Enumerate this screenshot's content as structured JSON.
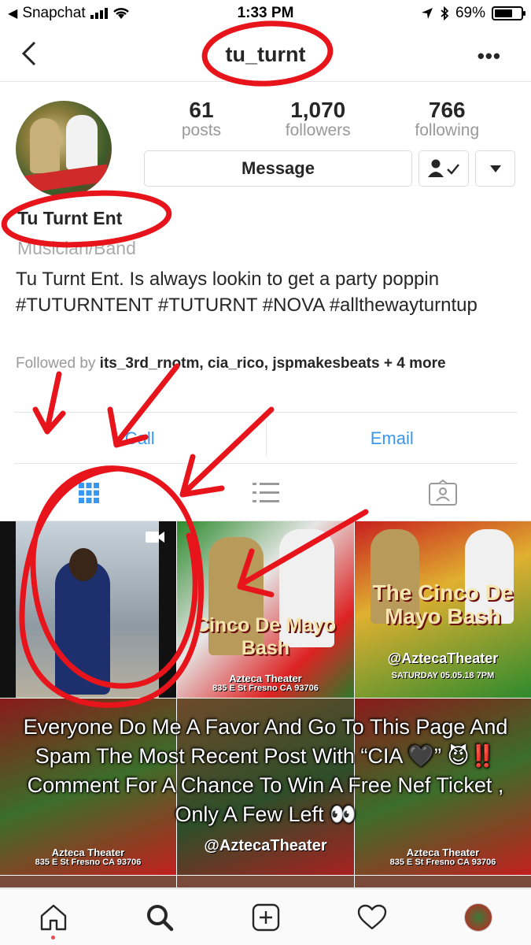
{
  "status_bar": {
    "carrier": "Snapchat",
    "time": "1:33 PM",
    "battery": "69%",
    "battery_level": 0.69
  },
  "nav": {
    "title": "tu_turnt"
  },
  "profile": {
    "stats": [
      {
        "value": "61",
        "label": "posts"
      },
      {
        "value": "1,070",
        "label": "followers"
      },
      {
        "value": "766",
        "label": "following"
      }
    ],
    "message_label": "Message",
    "name": "Tu Turnt Ent",
    "category": "Musician/Band",
    "bio": "Tu Turnt Ent. Is always lookin to get a party poppin #TUTURNTENT #TUTURNT #NOVA #allthewayturntup",
    "followed_prefix": "Followed by",
    "followed_names": "its_3rd_rnotm, cia_rico, jspmakesbeats",
    "followed_suffix": "+ 4 more"
  },
  "contact": {
    "left_label": "Call",
    "right_label": "Email"
  },
  "grid_posts": {
    "post2_title": "Cinco De Mayo Bash",
    "post2_venue": "Azteca Theater",
    "post2_address": "835 E St Fresno CA 93706",
    "post3_title": "The Cinco De Mayo Bash",
    "post3_handle": "@AztecaTheater",
    "post3_date": "SATURDAY 05.05.18 7PM",
    "row2_handle": "@AztecaTheater",
    "row2_venue": "Azteca Theater",
    "row2_address": "835 E St Fresno CA 93706"
  },
  "overlay_caption": "Everyone Do Me A Favor And Go To This Page And Spam The Most Recent Post With “CIA 🖤” 😈‼️ Comment For A Chance To Win A Free Nef Ticket , Only A Few Left 👀",
  "colors": {
    "link": "#3897f0",
    "annotation": "#e8141c",
    "notification_dot": "#ed4956"
  }
}
